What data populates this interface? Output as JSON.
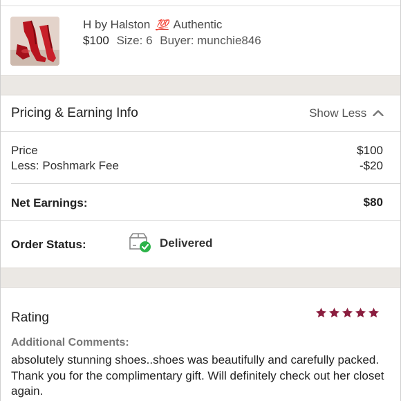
{
  "listing": {
    "title_brand": "H by Halston",
    "title_emoji": "💯",
    "title_suffix": "Authentic",
    "price": "$100",
    "size": "Size: 6",
    "buyer": "Buyer: munchie846",
    "thumbnail_icon": "red-shoes-photo"
  },
  "pricing": {
    "title": "Pricing & Earning Info",
    "toggle_label": "Show Less",
    "toggle_icon": "chevron-up-icon",
    "rows": [
      {
        "label": "Price",
        "value": "$100"
      },
      {
        "label": "Less: Poshmark Fee",
        "value": "-$20"
      }
    ],
    "net_label": "Net Earnings:",
    "net_value": "$80"
  },
  "order_status": {
    "label": "Order Status:",
    "value": "Delivered",
    "icon": "package-delivered-icon",
    "accent_color": "#2db34a"
  },
  "rating": {
    "title": "Rating",
    "stars": 5,
    "max_stars": 5,
    "star_color": "#8b1e3f",
    "comments_label": "Additional Comments:",
    "comments": "absolutely stunning shoes..shoes was beautifully and carefully packed. Thank you for the complimentary gift. Will definitely check out her closet again."
  }
}
